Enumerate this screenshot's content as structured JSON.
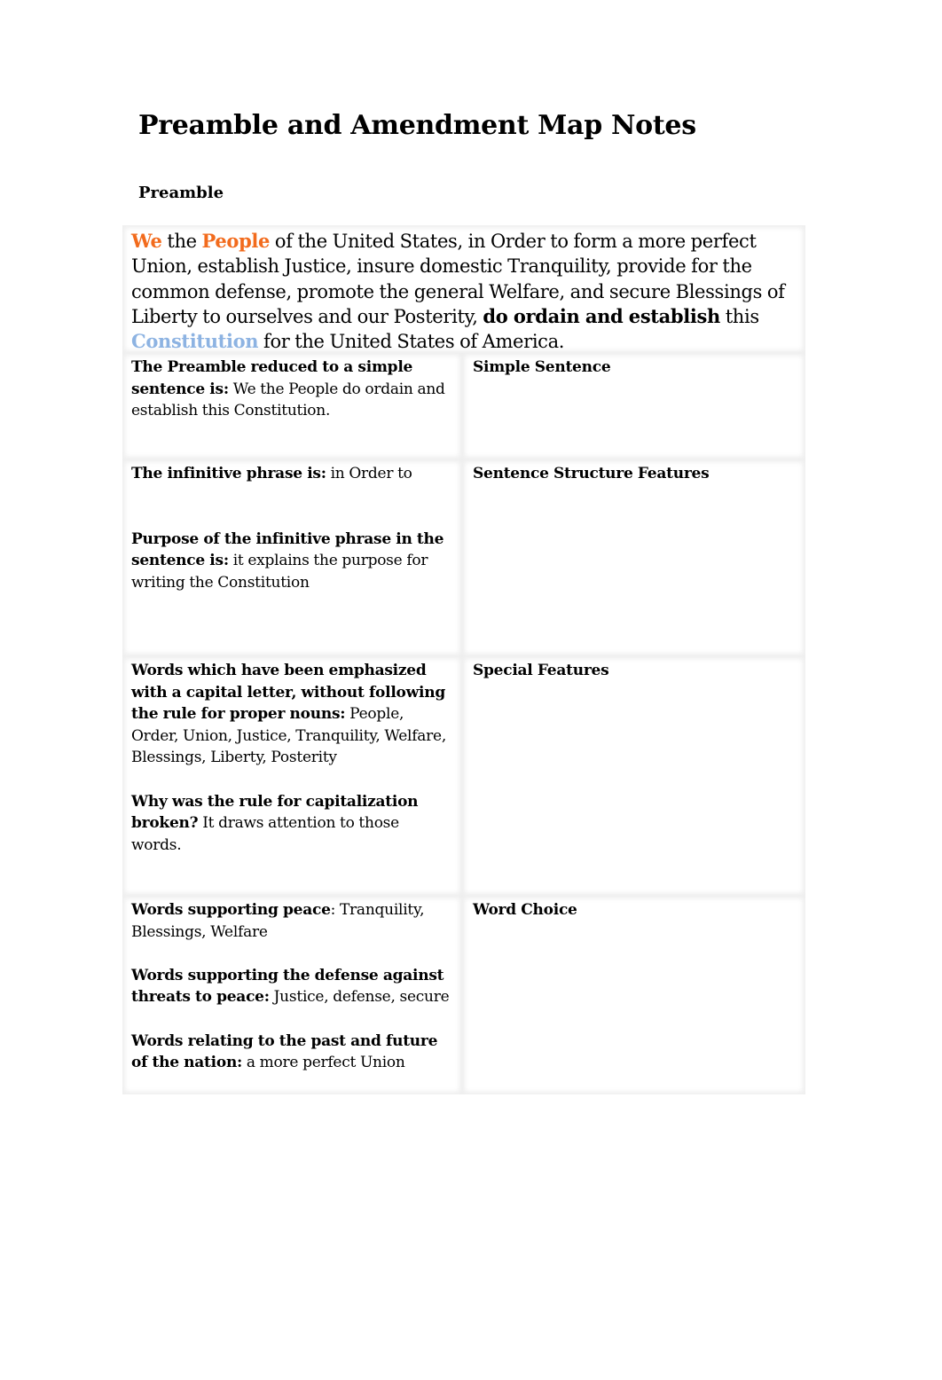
{
  "document": {
    "title": "Preamble and Amendment Map Notes",
    "section_heading": "Preamble"
  },
  "preamble": {
    "we": "We",
    "the": " the ",
    "people": "People",
    "text_1": " of the United States, in Order to form a more perfect Union, establish Justice, insure domestic Tranquility, provide for the common defense, promote the general Welfare, and secure Blessings of Liberty to ourselves and our Posterity, ",
    "ordain": "do ordain and establish",
    "text_2": " this ",
    "constitution": "Constitution",
    "text_3": " for the United States of America.",
    "colors": {
      "orange": "#f26b1d",
      "blue": "#8db3e2"
    }
  },
  "rows": [
    {
      "left": [
        {
          "label": "The Preamble reduced to a simple sentence is:",
          "value": " We the People do ordain and establish this Constitution."
        }
      ],
      "right_heading": "Simple Sentence"
    },
    {
      "left": [
        {
          "label": "The infinitive phrase is:",
          "value": " in Order to"
        },
        {
          "label": "Purpose of the infinitive phrase in the sentence is:",
          "value": " it explains the purpose for writing the Constitution"
        }
      ],
      "right_heading": "Sentence Structure Features"
    },
    {
      "left": [
        {
          "label": "Words which have been emphasized with a capital letter, without following the rule for proper nouns:",
          "value": " People, Order, Union, Justice, Tranquility, Welfare, Blessings, Liberty, Posterity"
        },
        {
          "label": "Why was the rule for capitalization broken?",
          "value": " It draws attention to those words."
        }
      ],
      "right_heading": "Special Features"
    },
    {
      "left": [
        {
          "label": "Words supporting peace",
          "value": ": Tranquility, Blessings, Welfare"
        },
        {
          "label": "Words supporting the defense against threats to peace:",
          "value": " Justice, defense, secure"
        },
        {
          "label": "Words relating to the past and future of the nation:",
          "value": " a more perfect Union"
        }
      ],
      "right_heading": "Word Choice"
    }
  ]
}
